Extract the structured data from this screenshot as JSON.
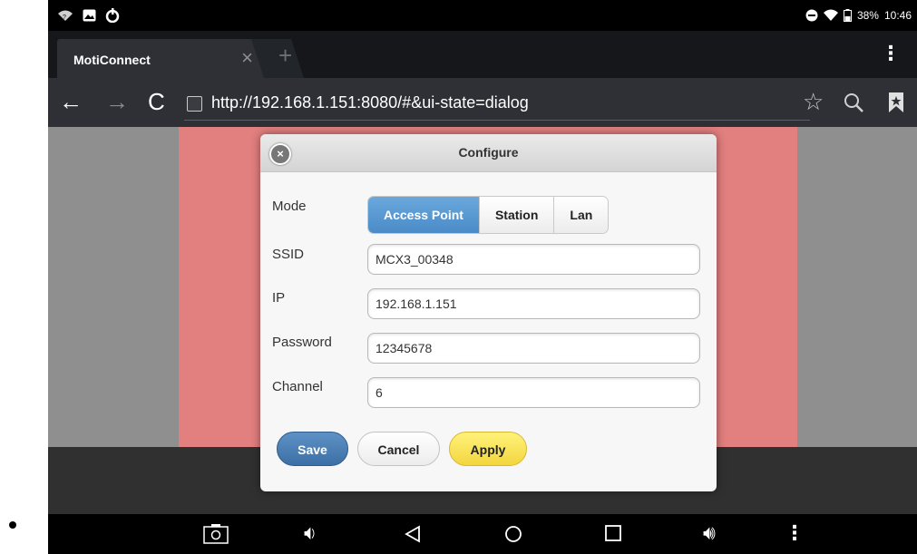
{
  "status_bar": {
    "left_icons": [
      "wifi-question-icon",
      "image-icon",
      "power-icon"
    ],
    "battery_percent": "38%",
    "time": "10:46"
  },
  "browser": {
    "tab_title": "MotiConnect",
    "url": "http://192.168.1.151:8080/#&ui-state=dialog"
  },
  "dialog": {
    "title": "Configure",
    "labels": {
      "mode": "Mode",
      "ssid": "SSID",
      "ip": "IP",
      "password": "Password",
      "channel": "Channel"
    },
    "mode_options": [
      "Access Point",
      "Station",
      "Lan"
    ],
    "selected_mode": "Access Point",
    "fields": {
      "ssid": "MCX3_00348",
      "ip": "192.168.1.151",
      "password": "12345678",
      "channel": "6"
    },
    "buttons": {
      "save": "Save",
      "cancel": "Cancel",
      "apply": "Apply"
    }
  },
  "colors": {
    "page_accent": "#e27f7f",
    "save_button": "#3c6fa5",
    "apply_button": "#f3d63e",
    "active_mode": "#4a8bc8"
  }
}
